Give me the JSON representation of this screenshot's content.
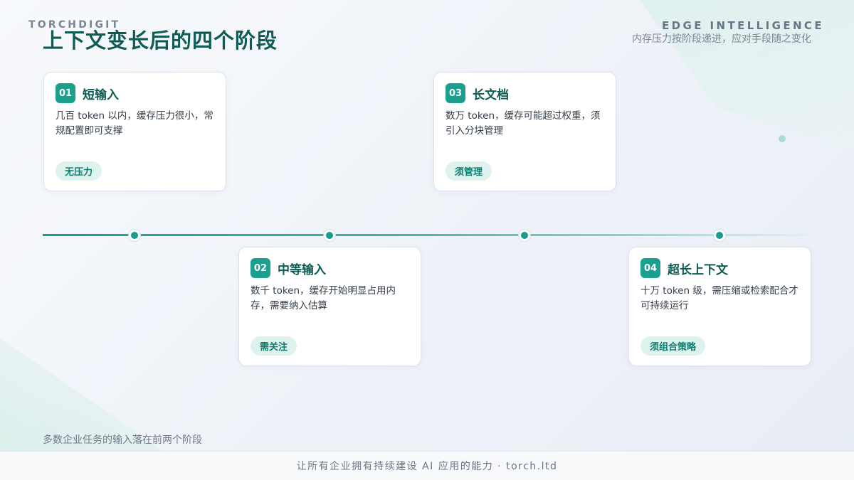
{
  "header": {
    "brand_left": "TORCHDIGIT",
    "brand_right": "EDGE INTELLIGENCE",
    "title": "上下文变长后的四个阶段",
    "subtitle": "内存压力按阶段递进，应对手段随之变化"
  },
  "stages": [
    {
      "num": "01",
      "title": "短输入",
      "desc": "几百 token 以内，缓存压力很小，常规配置即可支撑",
      "tag": "无压力"
    },
    {
      "num": "02",
      "title": "中等输入",
      "desc": "数千 token，缓存开始明显占用内存，需要纳入估算",
      "tag": "需关注"
    },
    {
      "num": "03",
      "title": "长文档",
      "desc": "数万 token，缓存可能超过权重，须引入分块管理",
      "tag": "须管理"
    },
    {
      "num": "04",
      "title": "超长上下文",
      "desc": "十万 token 级，需压缩或检索配合才可持续运行",
      "tag": "须组合策略"
    }
  ],
  "footnote": "多数企业任务的输入落在前两个阶段",
  "footer": {
    "text": "让所有企业拥有持续建设 AI 应用的能力 · torch.ltd"
  },
  "colors": {
    "accent": "#1ba08f",
    "title": "#0f5c54",
    "tag_bg": "#def2ee"
  }
}
